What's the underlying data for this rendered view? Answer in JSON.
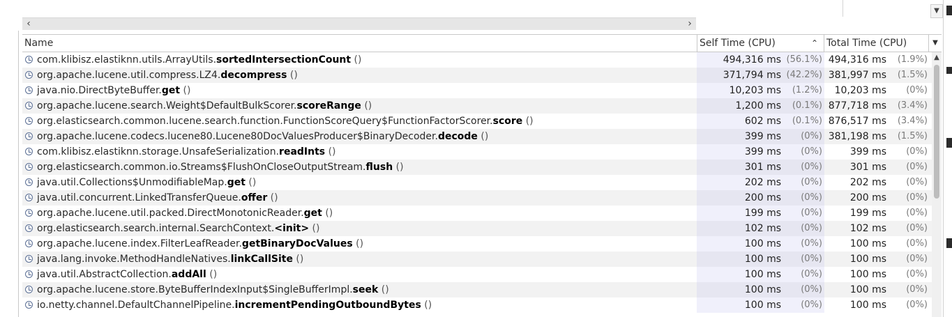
{
  "table": {
    "columns": {
      "name": "Name",
      "self": "Self Time (CPU)",
      "total": "Total Time (CPU)"
    },
    "sort_indicator": "^",
    "rows": [
      {
        "pkg": "com.klibisz.elastiknn.utils.ArrayUtils.",
        "method": "sortedIntersectionCount",
        "paren": " ()",
        "self": "494,316 ms",
        "self_pct": "(56.1%)",
        "total": "494,316 ms",
        "total_pct": "(1.9%)"
      },
      {
        "pkg": "org.apache.lucene.util.compress.LZ4.",
        "method": "decompress",
        "paren": " ()",
        "self": "371,794 ms",
        "self_pct": "(42.2%)",
        "total": "381,997 ms",
        "total_pct": "(1.5%)"
      },
      {
        "pkg": "java.nio.DirectByteBuffer.",
        "method": "get",
        "paren": " ()",
        "self": "10,203 ms",
        "self_pct": "(1.2%)",
        "total": "10,203 ms",
        "total_pct": "(0%)"
      },
      {
        "pkg": "org.apache.lucene.search.Weight$DefaultBulkScorer.",
        "method": "scoreRange",
        "paren": " ()",
        "self": "1,200 ms",
        "self_pct": "(0.1%)",
        "total": "877,718 ms",
        "total_pct": "(3.4%)"
      },
      {
        "pkg": "org.elasticsearch.common.lucene.search.function.FunctionScoreQuery$FunctionFactorScorer.",
        "method": "score",
        "paren": " ()",
        "self": "602 ms",
        "self_pct": "(0.1%)",
        "total": "876,517 ms",
        "total_pct": "(3.4%)"
      },
      {
        "pkg": "org.apache.lucene.codecs.lucene80.Lucene80DocValuesProducer$BinaryDecoder.",
        "method": "decode",
        "paren": " ()",
        "self": "399 ms",
        "self_pct": "(0%)",
        "total": "381,198 ms",
        "total_pct": "(1.5%)"
      },
      {
        "pkg": "com.klibisz.elastiknn.storage.UnsafeSerialization.",
        "method": "readInts",
        "paren": " ()",
        "self": "399 ms",
        "self_pct": "(0%)",
        "total": "399 ms",
        "total_pct": "(0%)"
      },
      {
        "pkg": "org.elasticsearch.common.io.Streams$FlushOnCloseOutputStream.",
        "method": "flush",
        "paren": " ()",
        "self": "301 ms",
        "self_pct": "(0%)",
        "total": "301 ms",
        "total_pct": "(0%)"
      },
      {
        "pkg": "java.util.Collections$UnmodifiableMap.",
        "method": "get",
        "paren": " ()",
        "self": "202 ms",
        "self_pct": "(0%)",
        "total": "202 ms",
        "total_pct": "(0%)"
      },
      {
        "pkg": "java.util.concurrent.LinkedTransferQueue.",
        "method": "offer",
        "paren": " ()",
        "self": "200 ms",
        "self_pct": "(0%)",
        "total": "200 ms",
        "total_pct": "(0%)"
      },
      {
        "pkg": "org.apache.lucene.util.packed.DirectMonotonicReader.",
        "method": "get",
        "paren": " ()",
        "self": "199 ms",
        "self_pct": "(0%)",
        "total": "199 ms",
        "total_pct": "(0%)"
      },
      {
        "pkg": "org.elasticsearch.search.internal.SearchContext.",
        "method": "<init>",
        "paren": " ()",
        "self": "102 ms",
        "self_pct": "(0%)",
        "total": "102 ms",
        "total_pct": "(0%)"
      },
      {
        "pkg": "org.apache.lucene.index.FilterLeafReader.",
        "method": "getBinaryDocValues",
        "paren": " ()",
        "self": "100 ms",
        "self_pct": "(0%)",
        "total": "100 ms",
        "total_pct": "(0%)"
      },
      {
        "pkg": "java.lang.invoke.MethodHandleNatives.",
        "method": "linkCallSite",
        "paren": " ()",
        "self": "100 ms",
        "self_pct": "(0%)",
        "total": "100 ms",
        "total_pct": "(0%)"
      },
      {
        "pkg": "java.util.AbstractCollection.",
        "method": "addAll",
        "paren": " ()",
        "self": "100 ms",
        "self_pct": "(0%)",
        "total": "100 ms",
        "total_pct": "(0%)"
      },
      {
        "pkg": "org.apache.lucene.store.ByteBufferIndexInput$SingleBufferImpl.",
        "method": "seek",
        "paren": " ()",
        "self": "100 ms",
        "self_pct": "(0%)",
        "total": "100 ms",
        "total_pct": "(0%)"
      },
      {
        "pkg": "io.netty.channel.DefaultChannelPipeline.",
        "method": "incrementPendingOutboundBytes",
        "paren": " ()",
        "self": "100 ms",
        "self_pct": "(0%)",
        "total": "100 ms",
        "total_pct": "(0%)"
      }
    ]
  },
  "icons": {
    "row": "clock-icon",
    "scroll_left": "chevron-left-icon",
    "scroll_right": "chevron-right-icon",
    "column_menu": "chevron-down-icon"
  },
  "colors": {
    "self_column_bg": "#f0f0fb",
    "alt_row_bg": "#f2f2f2"
  }
}
